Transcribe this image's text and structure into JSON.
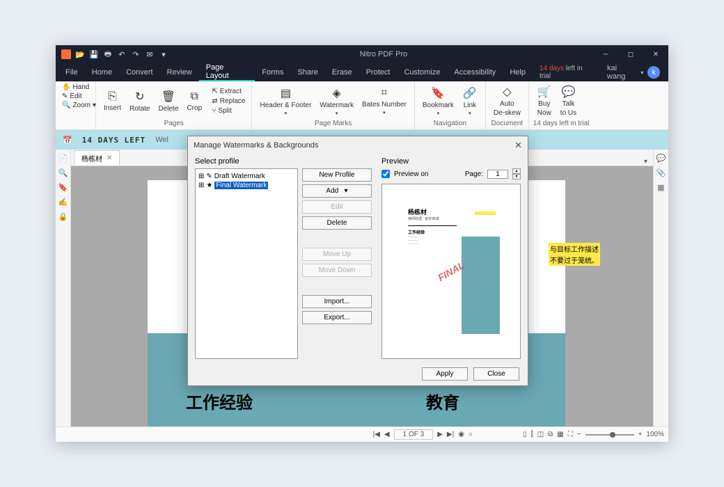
{
  "title": "Nitro PDF Pro",
  "menus": [
    "File",
    "Home",
    "Convert",
    "Review",
    "Page Layout",
    "Forms",
    "Share",
    "Erase",
    "Protect",
    "Customize",
    "Accessibility",
    "Help"
  ],
  "active_menu": 4,
  "trial": {
    "days": "14 days",
    "rest": "left in trial"
  },
  "user": {
    "name": "kai wang",
    "initial": "k"
  },
  "ribbon": {
    "quick": [
      "Hand",
      "Edit",
      "Zoom"
    ],
    "pages": {
      "items": [
        "Insert",
        "Rotate",
        "Delete",
        "Crop"
      ],
      "extra": [
        "Extract",
        "Replace",
        "Split"
      ],
      "label": "Pages"
    },
    "marks": {
      "items": [
        "Header & Footer",
        "Watermark",
        "Bates Number"
      ],
      "label": "Page Marks"
    },
    "nav": {
      "items": [
        "Bookmark",
        "Link"
      ],
      "label": "Navigation"
    },
    "deskew": {
      "top": "Auto",
      "mid": "De-skew",
      "bot": "Document"
    },
    "buy": {
      "buy": "Buy",
      "now": "Now",
      "talk": "Talk",
      "us": "to Us",
      "trial": "14 days left in trial"
    }
  },
  "banner": {
    "icon": "📅",
    "days": "14 DAYS LEFT",
    "wel": "Wel"
  },
  "tab": {
    "name": "杨栋材"
  },
  "page": {
    "section1": "工作经验",
    "section2": "教育",
    "hl1": "与目标工作描述",
    "hl2": "不要过于笼统。"
  },
  "status": {
    "page": "1 OF 3",
    "zoom": "100%"
  },
  "dialog": {
    "title": "Manage Watermarks & Backgrounds",
    "select": "Select profile",
    "profiles": [
      "Draft Watermark",
      "Final Watermark"
    ],
    "selected": 1,
    "buttons": {
      "new": "New Profile",
      "add": "Add",
      "edit": "Edit",
      "delete": "Delete",
      "up": "Move Up",
      "down": "Move Down",
      "import": "Import...",
      "export": "Export..."
    },
    "preview": {
      "label": "Preview",
      "on": "Preview on",
      "page": "Page:",
      "num": "1"
    },
    "doc": {
      "name": "杨栋材",
      "sub": "律师助理 · 欧利商城",
      "wm": "FINAL"
    },
    "footer": {
      "apply": "Apply",
      "close": "Close"
    }
  }
}
